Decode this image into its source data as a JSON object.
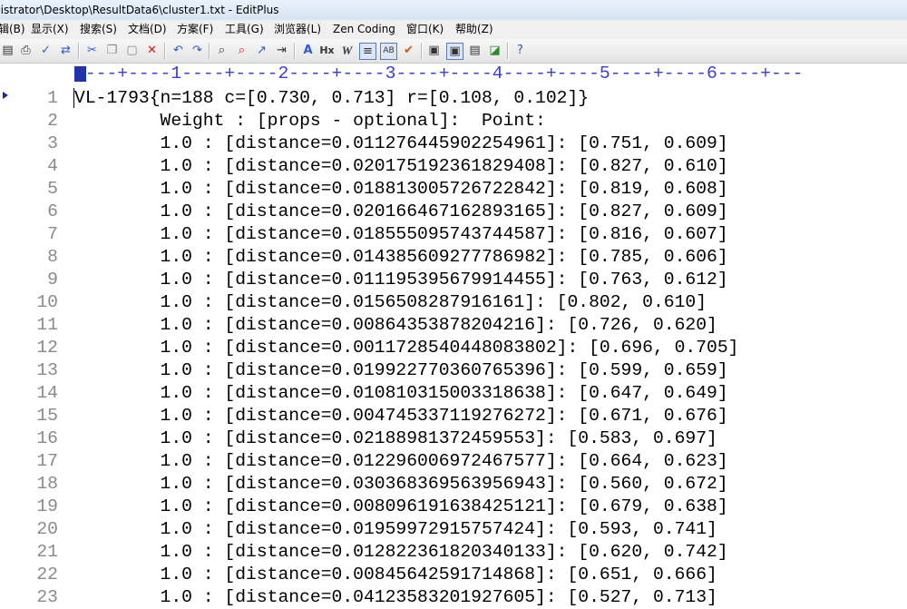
{
  "window": {
    "title": "nistrator\\Desktop\\ResultData6\\cluster1.txt - EditPlus"
  },
  "menu": [
    "辑(B)",
    "显示(X)",
    "搜索(S)",
    "文档(D)",
    "方案(F)",
    "工具(G)",
    "浏览器(L)",
    "Zen Coding",
    "窗口(K)",
    "帮助(Z)"
  ],
  "toolbar": {
    "icons": [
      "print-preview-icon",
      "print-icon",
      "spellcheck-icon",
      "replace-icon",
      "cut-icon",
      "copy-icon",
      "paste-icon",
      "delete-icon",
      "undo-icon",
      "redo-icon",
      "find-icon",
      "find-in-files-icon",
      "goto-icon",
      "insert-icon",
      "font-size-icon",
      "heading-icon",
      "italic-icon",
      "word-wrap-icon",
      "column-select-icon",
      "check-icon",
      "panel-1-icon",
      "panel-2-icon",
      "panel-3-icon",
      "browser-icon",
      "help-icon"
    ]
  },
  "ruler": {
    "text": "----+----1----+----2----+----3----+----4----+----5----+----6----+---"
  },
  "editor": {
    "lines": [
      {
        "n": "1",
        "text": "VL-1793{n=188 c=[0.730, 0.713] r=[0.108, 0.102]}"
      },
      {
        "n": "2",
        "text": "        Weight : [props - optional]:  Point:"
      },
      {
        "n": "3",
        "text": "        1.0 : [distance=0.011276445902254961]: [0.751, 0.609]"
      },
      {
        "n": "4",
        "text": "        1.0 : [distance=0.020175192361829408]: [0.827, 0.610]"
      },
      {
        "n": "5",
        "text": "        1.0 : [distance=0.018813005726722842]: [0.819, 0.608]"
      },
      {
        "n": "6",
        "text": "        1.0 : [distance=0.020166467162893165]: [0.827, 0.609]"
      },
      {
        "n": "7",
        "text": "        1.0 : [distance=0.018555095743744587]: [0.816, 0.607]"
      },
      {
        "n": "8",
        "text": "        1.0 : [distance=0.014385609277786982]: [0.785, 0.606]"
      },
      {
        "n": "9",
        "text": "        1.0 : [distance=0.011195395679914455]: [0.763, 0.612]"
      },
      {
        "n": "10",
        "text": "        1.0 : [distance=0.0156508287916161]: [0.802, 0.610]"
      },
      {
        "n": "11",
        "text": "        1.0 : [distance=0.0086435387820421 6]: [0.726, 0.620]"
      },
      {
        "n": "12",
        "text": "        1.0 : [distance=0.0011728540448083802]: [0.696, 0.705]"
      },
      {
        "n": "13",
        "text": "        1.0 : [distance=0.019922770360765396]: [0.599, 0.659]"
      },
      {
        "n": "14",
        "text": "        1.0 : [distance=0.010810315003318638]: [0.647, 0.649]"
      },
      {
        "n": "15",
        "text": "        1.0 : [distance=0.004745337119276272]: [0.671, 0.676]"
      },
      {
        "n": "16",
        "text": "        1.0 : [distance=0.0218898137245955 3]: [0.583, 0.697]"
      },
      {
        "n": "17",
        "text": "        1.0 : [distance=0.012296006972467577]: [0.664, 0.623]"
      },
      {
        "n": "18",
        "text": "        1.0 : [distance=0.030368369563956943]: [0.560, 0.672]"
      },
      {
        "n": "19",
        "text": "        1.0 : [distance=0.008096191638425121]: [0.679, 0.638]"
      },
      {
        "n": "20",
        "text": "        1.0 : [distance=0.0195997291575742 4]: [0.593, 0.741]"
      },
      {
        "n": "21",
        "text": "        1.0 : [distance=0.012822361820340133]: [0.620, 0.742]"
      },
      {
        "n": "22",
        "text": "        1.0 : [distance=0.0084564259171486 8]: [0.651, 0.666]"
      },
      {
        "n": "23",
        "text": "        1.0 : [distance=0.0412358320192760 5]: [0.527, 0.713]"
      }
    ]
  }
}
